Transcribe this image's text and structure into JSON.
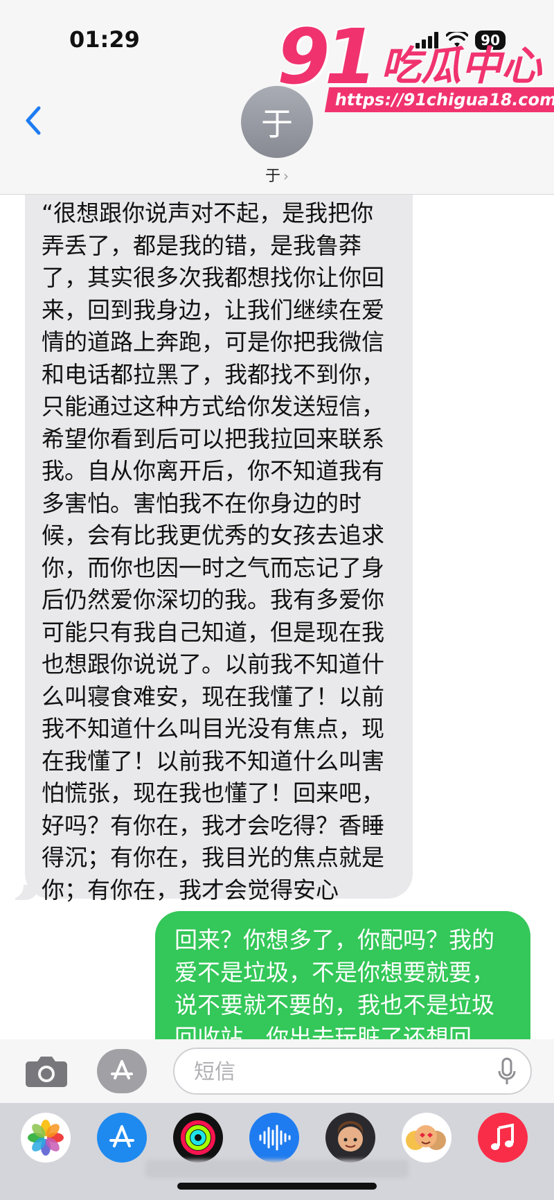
{
  "status_bar": {
    "time": "01:29",
    "battery": "90"
  },
  "header": {
    "avatar_initial": "于",
    "contact_name": "于",
    "contact_chevron": "›"
  },
  "watermark": {
    "number": "91",
    "title": "吃瓜中心",
    "url": "https://91chigua18.com"
  },
  "messages": [
    {
      "direction": "incoming",
      "text": "“很想跟你说声对不起，是我把你弄丢了，都是我的错，是我鲁莽了，其实很多次我都想找你让你回来，回到我身边，让我们继续在爱情的道路上奔跑，可是你把我微信和电话都拉黑了，我都找不到你，只能通过这种方式给你发送短信，希望你看到后可以把我拉回来联系我。自从你离开后，你不知道我有多害怕。害怕我不在你身边的时候，会有比我更优秀的女孩去追求你，而你也因一时之气而忘记了身后仍然爱你深切的我。我有多爱你可能只有我自己知道，但是现在我也想跟你说说了。以前我不知道什么叫寝食难安，现在我懂了！以前我不知道什么叫目光没有焦点，现在我懂了！以前我不知道什么叫害怕慌张，现在我也懂了！回来吧，好吗？有你在，我才会吃得？香睡得沉；有你在，我目光的焦点就是你；有你在，我才会觉得安心"
    },
    {
      "direction": "outgoing",
      "text": "回来？你想多了，你配吗？我的爱不是垃圾，不是你想要就要，说不要就不要的，我也不是垃圾回收站，你出去玩脏了还想回"
    }
  ],
  "input_bar": {
    "placeholder": "短信"
  },
  "app_drawer": {
    "apps": [
      "photos-icon",
      "app-store-icon",
      "fitness-icon",
      "voice-memo-icon",
      "memoji-icon",
      "animoji-icon",
      "music-icon"
    ]
  },
  "colors": {
    "incoming_bubble": "#e9e9eb",
    "outgoing_bubble": "#34c759",
    "accent": "#1e7cf2",
    "watermark": "#f0336f"
  }
}
